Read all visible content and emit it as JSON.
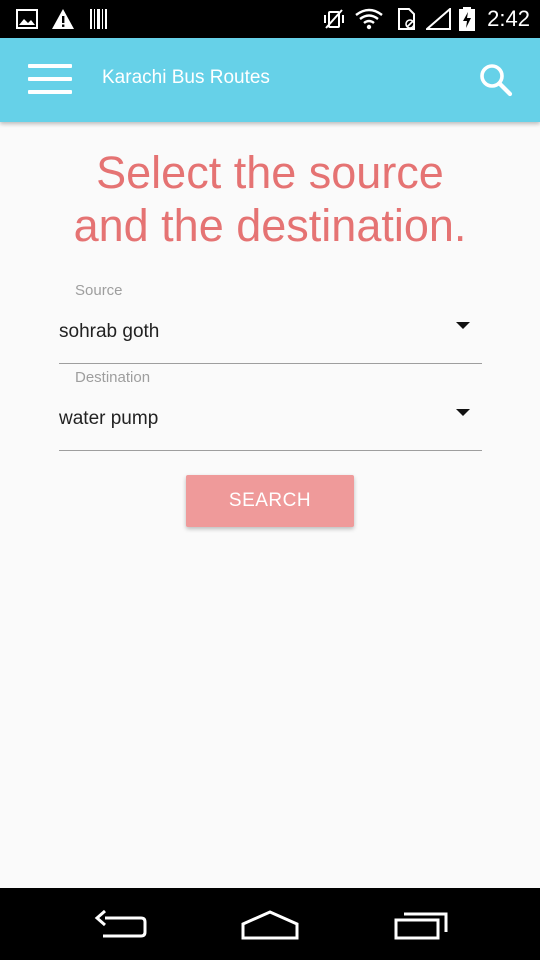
{
  "status_bar": {
    "time": "2:42",
    "icons": [
      "image-icon",
      "warning-icon",
      "barcode-icon",
      "vibrate-off-icon",
      "wifi-icon",
      "sim-card-icon",
      "signal-icon",
      "battery-charging-icon"
    ]
  },
  "app_bar": {
    "title": "Karachi Bus Routes",
    "color": "#66d1e8",
    "menu_icon": "menu-icon",
    "search_icon": "search-icon"
  },
  "main": {
    "heading_line1": "Select the source",
    "heading_line2": "and the destination.",
    "accent_color": "#e57373",
    "source": {
      "label": "Source",
      "selected": "sohrab goth"
    },
    "destination": {
      "label": "Destination",
      "selected": "water pump"
    },
    "search_button": {
      "label": "SEARCH",
      "color": "#ef9a9a"
    }
  },
  "nav_bar": {
    "icons": [
      "back-icon",
      "home-icon",
      "recents-icon"
    ]
  }
}
